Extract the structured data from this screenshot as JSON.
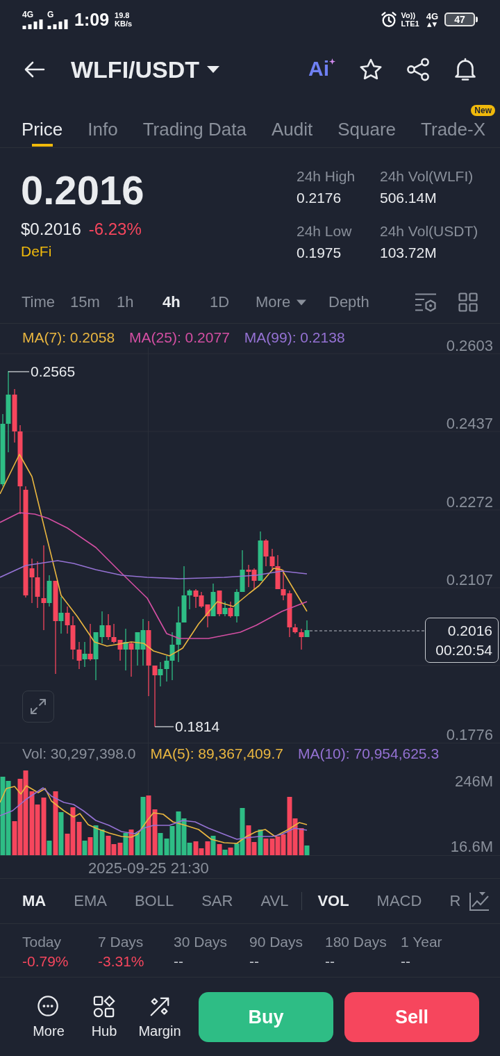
{
  "status_bar": {
    "sim1_network": "4G",
    "sim2_network": "G",
    "time": "1:09",
    "speed": "19.8",
    "speed_unit": "KB/s",
    "volte": "Vo))",
    "volte_sim": "LTE1",
    "data_network": "4G",
    "battery": "47"
  },
  "header": {
    "pair": "WLFI/USDT",
    "ai_label": "Ai"
  },
  "tabs": [
    {
      "label": "Price",
      "selected": true
    },
    {
      "label": "Info",
      "selected": false
    },
    {
      "label": "Trading Data",
      "selected": false
    },
    {
      "label": "Audit",
      "selected": false
    },
    {
      "label": "Square",
      "selected": false
    },
    {
      "label": "Trade-X",
      "selected": false,
      "badge": "New"
    }
  ],
  "summary": {
    "price": "0.2016",
    "fiat_price": "$0.2016",
    "change": "-6.23%",
    "negative": true,
    "tag": "DeFi",
    "stats": [
      {
        "label": "24h High",
        "value": "0.2176"
      },
      {
        "label": "24h Vol(WLFI)",
        "value": "506.14M"
      },
      {
        "label": "24h Low",
        "value": "0.1975"
      },
      {
        "label": "24h Vol(USDT)",
        "value": "103.72M"
      }
    ]
  },
  "intervals": [
    {
      "label": "Time",
      "kind": "option",
      "selected": false
    },
    {
      "label": "15m",
      "kind": "option",
      "selected": false
    },
    {
      "label": "1h",
      "kind": "option",
      "selected": false
    },
    {
      "label": "4h",
      "kind": "option",
      "selected": true
    },
    {
      "label": "1D",
      "kind": "option",
      "selected": false
    },
    {
      "label": "More",
      "kind": "dropdown",
      "selected": false
    },
    {
      "label": "Depth",
      "kind": "option",
      "selected": false
    }
  ],
  "price_chart": {
    "legend": [
      {
        "label": "MA(7): 0.2058",
        "color": "#e9b640"
      },
      {
        "label": "MA(25): 0.2077",
        "color": "#d44fa3"
      },
      {
        "label": "MA(99): 0.2138",
        "color": "#9572d4"
      }
    ],
    "axis_labels": [
      "0.2603",
      "0.2437",
      "0.2272",
      "0.2107",
      "0.1776"
    ],
    "high_label": "0.2565",
    "low_label": "0.1814",
    "last_price": "0.2016",
    "countdown": "00:20:54"
  },
  "volume_chart": {
    "legend": [
      {
        "label": "Vol: 30,297,398.0",
        "color": "#8a909b"
      },
      {
        "label": "MA(5): 89,367,409.7",
        "color": "#e9b640"
      },
      {
        "label": "MA(10): 70,954,625.3",
        "color": "#9572d4"
      }
    ],
    "axis_labels": [
      "246M",
      "16.6M"
    ],
    "date": "2025-09-25 21:30"
  },
  "indicators": [
    {
      "label": "MA",
      "divider_before": false,
      "selected": true
    },
    {
      "label": "EMA",
      "divider_before": false,
      "selected": false
    },
    {
      "label": "BOLL",
      "divider_before": false,
      "selected": false
    },
    {
      "label": "SAR",
      "divider_before": false,
      "selected": false
    },
    {
      "label": "AVL",
      "divider_before": false,
      "selected": false
    },
    {
      "label": "VOL",
      "divider_before": true,
      "selected": true
    },
    {
      "label": "MACD",
      "divider_before": false,
      "selected": false
    },
    {
      "label": "R",
      "divider_before": false,
      "selected": false
    }
  ],
  "performance": [
    {
      "period": "Today",
      "change": "-0.79%",
      "negative": true
    },
    {
      "period": "7 Days",
      "change": "-3.31%",
      "negative": true
    },
    {
      "period": "30 Days",
      "change": "--",
      "negative": false
    },
    {
      "period": "90 Days",
      "change": "--",
      "negative": false
    },
    {
      "period": "180 Days",
      "change": "--",
      "negative": false
    },
    {
      "period": "1 Year",
      "change": "--",
      "negative": false
    }
  ],
  "actions": [
    {
      "label": "More",
      "kind": "more"
    },
    {
      "label": "Hub",
      "kind": "hub"
    },
    {
      "label": "Margin",
      "kind": "margin"
    }
  ],
  "trade_buttons": [
    {
      "label": "Buy",
      "kind": "buy"
    },
    {
      "label": "Sell",
      "kind": "sell"
    }
  ]
}
